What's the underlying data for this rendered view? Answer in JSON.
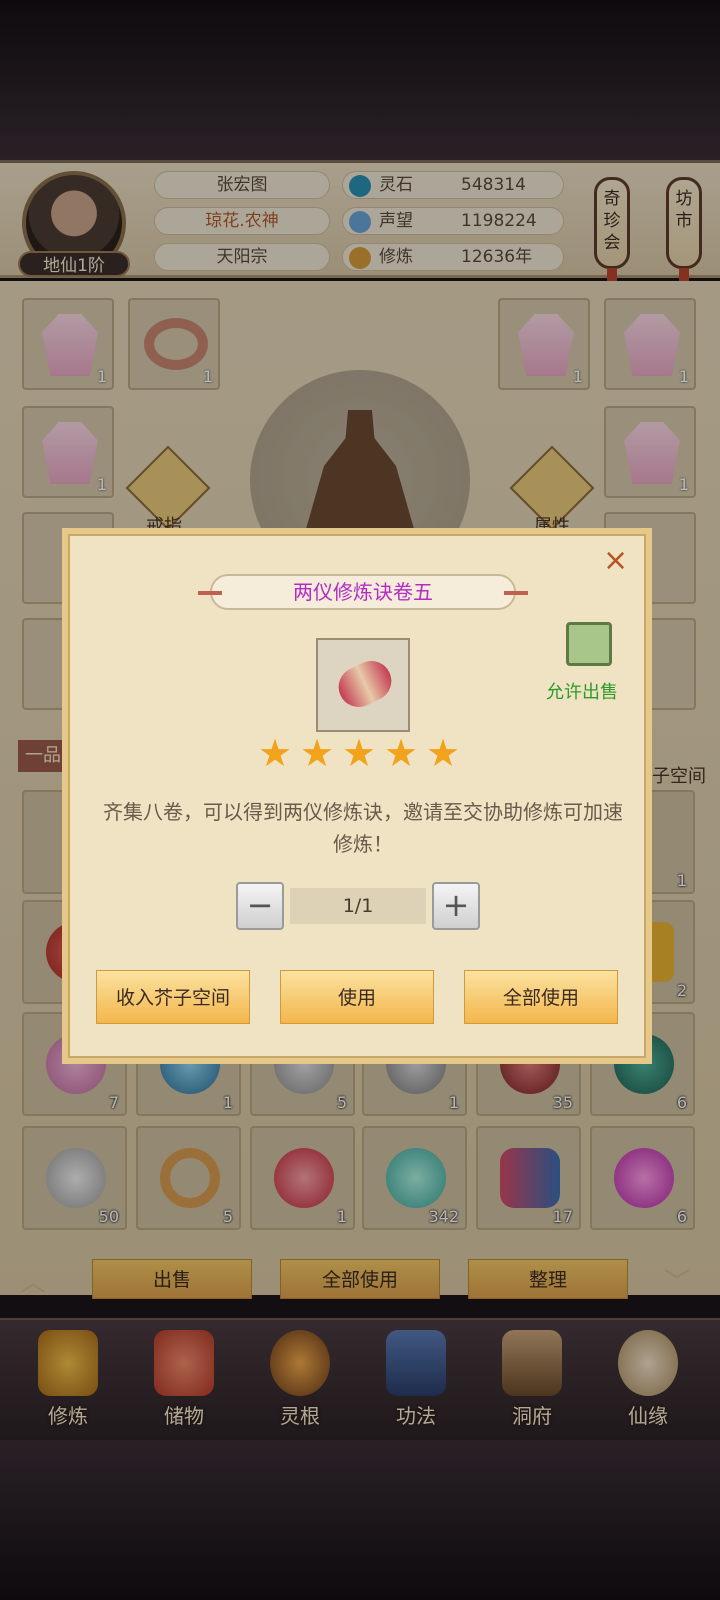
{
  "player": {
    "name": "张宏图",
    "title": "琼花.农神",
    "sect": "天阳宗",
    "rank": "地仙1阶"
  },
  "resources": [
    {
      "label": "灵石",
      "value": "548314",
      "icon": "spirit-stone-icon"
    },
    {
      "label": "声望",
      "value": "1198224",
      "icon": "reputation-icon"
    },
    {
      "label": "修炼",
      "value": "12636年",
      "icon": "cultivation-icon"
    }
  ],
  "side_buttons": {
    "treasure": "奇珍会",
    "market": "坊市"
  },
  "equipment": {
    "counts": [
      "1",
      "1",
      "1",
      "1",
      "1",
      "1"
    ],
    "ring_label": "戒指",
    "attr_label": "属性",
    "grade_label": "一品",
    "storage_label": "子空间"
  },
  "inventory": {
    "row1_counts": [
      "7",
      "1",
      "5",
      "1",
      "35",
      "6"
    ],
    "row2_counts": [
      "50",
      "5",
      "1",
      "342",
      "17",
      "6"
    ],
    "right_col_counts": [
      "1",
      "2"
    ]
  },
  "actions": {
    "sell": "出售",
    "use_all": "全部使用",
    "sort": "整理"
  },
  "nav": [
    {
      "label": "修炼",
      "icon": "cultivate-icon"
    },
    {
      "label": "储物",
      "icon": "storage-bag-icon"
    },
    {
      "label": "灵根",
      "icon": "spirit-root-icon"
    },
    {
      "label": "功法",
      "icon": "technique-book-icon"
    },
    {
      "label": "洞府",
      "icon": "cave-residence-icon"
    },
    {
      "label": "仙缘",
      "icon": "immortal-fate-icon"
    }
  ],
  "dialog": {
    "close": "×",
    "title": "两仪修炼诀卷五",
    "sell_status": "允许出售",
    "stars": 5,
    "description": "齐集八卷，可以得到两仪修炼诀，邀请至交协助修炼可加速修炼！",
    "minus": "−",
    "plus": "+",
    "quantity": "1/1",
    "btn_store": "收入芥子空间",
    "btn_use": "使用",
    "btn_use_all": "全部使用"
  },
  "colors": {
    "title_purple": "#b52bc8",
    "sell_green": "#2f9a2b",
    "star_gold": "#f2a21b",
    "button_gold": "#f3b64b"
  }
}
